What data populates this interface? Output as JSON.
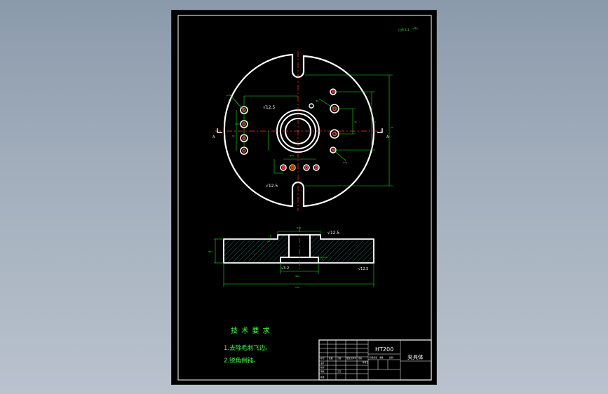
{
  "sheet": {
    "scale_note": "比例 1:1",
    "roughness_note": "√Ra"
  },
  "plan_view": {
    "section_labels": [
      "A",
      "A"
    ],
    "roughness_marks": [
      "√12.5",
      "√12.5"
    ],
    "dim_labels": [
      "R5",
      "Φ8",
      "Φ14",
      "Φ26",
      "60",
      "40",
      "35",
      "82"
    ]
  },
  "section_view": {
    "labels": [
      "√12.5",
      "√3.2",
      "√12.5"
    ],
    "dims": [
      "Φ14",
      "Φ52",
      "Φ26",
      "10",
      "6",
      "160"
    ]
  },
  "tech_requirements": {
    "title": "技 术 要 求",
    "items": [
      "1.去除毛刺飞边。",
      "2.锐角倒钝。"
    ]
  },
  "title_block": {
    "material": "HT200",
    "part_name": "夹具体",
    "row_labels": [
      "标记",
      "处数",
      "分区",
      "更改文件号",
      "签名",
      "年月日"
    ],
    "sub_labels": [
      "设计",
      "校对",
      "审核",
      "工艺",
      "批准"
    ],
    "sheet_info": [
      "阶段标记",
      "重量",
      "比例"
    ]
  },
  "colors": {
    "outline": "#ffffff",
    "dimension": "#22dd22",
    "center": "#ff3333",
    "annotation": "#44ff44",
    "title": "#ffffff"
  }
}
